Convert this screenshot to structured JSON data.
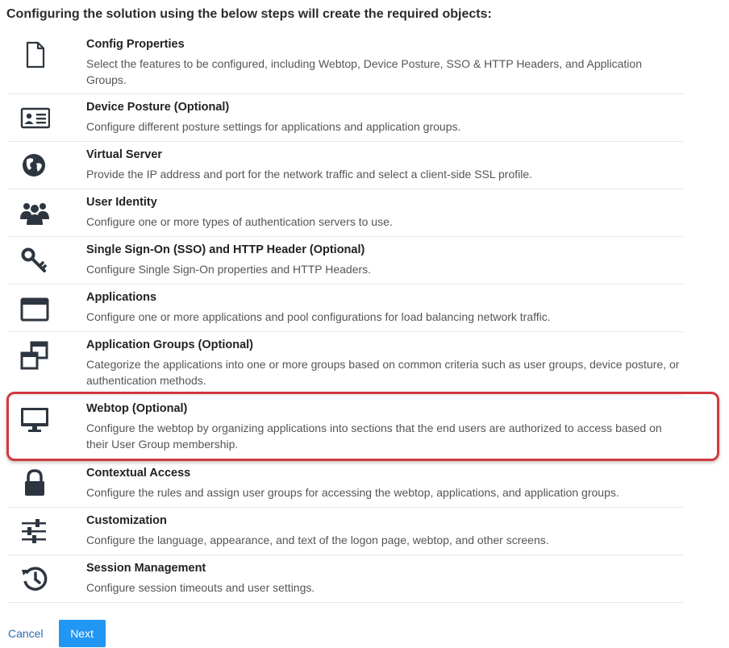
{
  "page_title": "Configuring the solution using the below steps will create the required objects:",
  "steps": [
    {
      "icon": "document-icon",
      "title": "Config Properties",
      "description": "Select the features to be configured, including Webtop, Device Posture, SSO & HTTP Headers, and Application Groups."
    },
    {
      "icon": "id-card-icon",
      "title": "Device Posture (Optional)",
      "description": "Configure different posture settings for applications and application groups."
    },
    {
      "icon": "globe-icon",
      "title": "Virtual Server",
      "description": "Provide the IP address and port for the network traffic and select a client-side SSL profile."
    },
    {
      "icon": "users-icon",
      "title": "User Identity",
      "description": "Configure one or more types of authentication servers to use."
    },
    {
      "icon": "key-icon",
      "title": "Single Sign-On (SSO) and HTTP Header (Optional)",
      "description": "Configure Single Sign-On properties and HTTP Headers."
    },
    {
      "icon": "window-icon",
      "title": "Applications",
      "description": "Configure one or more applications and pool configurations for load balancing network traffic."
    },
    {
      "icon": "clone-icon",
      "title": "Application Groups (Optional)",
      "description": "Categorize the applications into one or more groups based on common criteria such as user groups, device posture, or authentication methods."
    },
    {
      "icon": "monitor-icon",
      "title": "Webtop (Optional)",
      "description": "Configure the webtop by organizing applications into sections that the end users are authorized to access based on their User Group membership."
    },
    {
      "icon": "lock-icon",
      "title": "Contextual Access",
      "description": "Configure the rules and assign user groups for accessing the webtop, applications, and application groups."
    },
    {
      "icon": "sliders-icon",
      "title": "Customization",
      "description": "Configure the language, appearance, and text of the logon page, webtop, and other screens."
    },
    {
      "icon": "history-icon",
      "title": "Session Management",
      "description": "Configure session timeouts and user settings."
    }
  ],
  "footer": {
    "cancel_label": "Cancel",
    "next_label": "Next"
  },
  "colors": {
    "accent": "#2196f3",
    "highlight": "#d0393e",
    "icon": "#2d3640"
  }
}
